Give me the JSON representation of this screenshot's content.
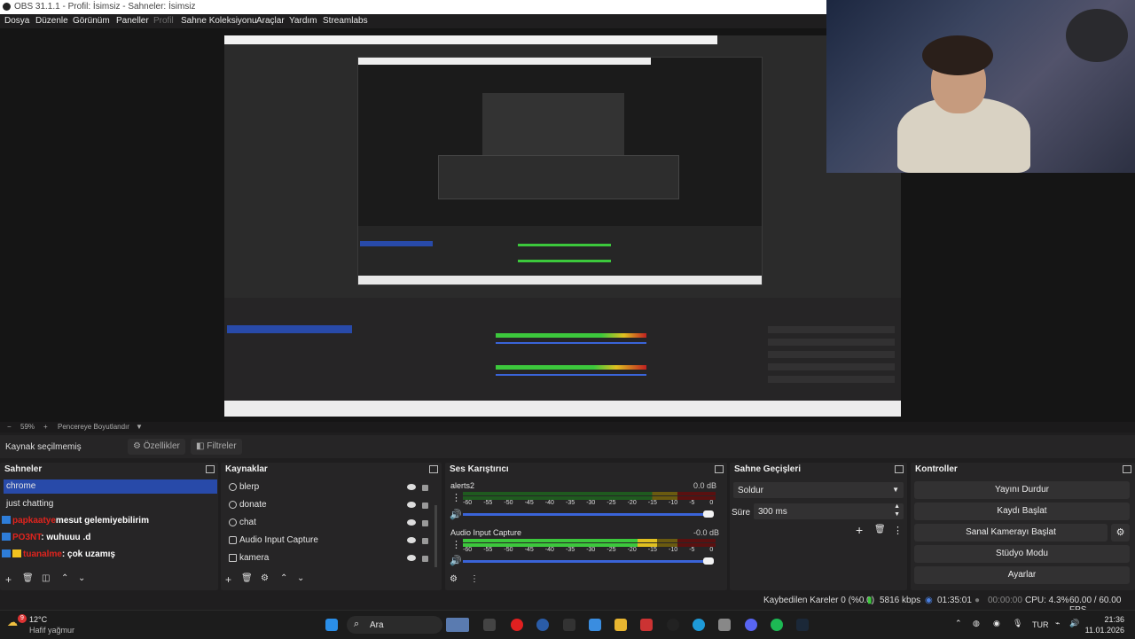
{
  "window": {
    "title": "OBS 31.1.1 - Profil: İsimsiz - Sahneler: İsimsiz"
  },
  "menu": {
    "items": [
      "Dosya",
      "Düzenle",
      "Görünüm",
      "Paneller",
      "Profil",
      "Sahne Koleksiyonu",
      "Araçlar",
      "Yardım",
      "Streamlabs"
    ]
  },
  "zoom": {
    "minus": "−",
    "value": "59%",
    "plus": "+",
    "fit_label": "Pencereye Boyutlandır"
  },
  "source_toolbar": {
    "none_selected": "Kaynak seçilmemiş",
    "properties": "Özellikler",
    "filters": "Filtreler"
  },
  "scenes": {
    "title": "Sahneler",
    "items": [
      "chrome",
      "just chatting"
    ],
    "selected": "chrome",
    "chat_overlay": [
      {
        "user": "papkaatye",
        "message": "mesut gelemiyebilirim"
      },
      {
        "user": "PO3NT",
        "message": ": wuhuuu .d"
      },
      {
        "user": "tuanalme",
        "message": ": çok uzamış"
      }
    ]
  },
  "sources": {
    "title": "Kaynaklar",
    "items": [
      {
        "name": "blerp",
        "icon": "browser-icon"
      },
      {
        "name": "donate",
        "icon": "browser-icon"
      },
      {
        "name": "chat",
        "icon": "browser-icon"
      },
      {
        "name": "Audio Input Capture",
        "icon": "microphone-icon"
      },
      {
        "name": "kamera",
        "icon": "camera-icon"
      }
    ]
  },
  "mixer": {
    "title": "Ses Karıştırıcı",
    "channels": [
      {
        "name": "alerts2",
        "db": "0.0 dB",
        "level": 0.0
      },
      {
        "name": "Audio Input Capture",
        "db": "-0.0 dB",
        "level": 0.77
      }
    ],
    "scale": [
      "-60",
      "-55",
      "-50",
      "-45",
      "-40",
      "-35",
      "-30",
      "-25",
      "-20",
      "-15",
      "-10",
      "-5",
      "0"
    ]
  },
  "transitions": {
    "title": "Sahne Geçişleri",
    "selected": "Soldur",
    "duration_label": "Süre",
    "duration": "300 ms"
  },
  "controls": {
    "title": "Kontroller",
    "buttons": [
      "Yayını Durdur",
      "Kaydı Başlat",
      "Sanal Kamerayı Başlat",
      "Stüdyo Modu",
      "Ayarlar"
    ]
  },
  "status": {
    "dropped": "Kaybedilen Kareler 0 (%0.0)",
    "bitrate": "5816 kbps",
    "stream_time": "01:35:01",
    "rec_time": "00:00:00",
    "cpu": "CPU: 4.3%",
    "fps": "60.00 / 60.00 FPS"
  },
  "taskbar": {
    "weather_temp": "12°C",
    "weather_desc": "Hafif yağmur",
    "weather_badge": "9",
    "search": "Ara",
    "lang": "TUR",
    "time": "21:36",
    "date": "11.01.2026"
  },
  "colors": {
    "selection": "#284aa9",
    "meter_green": "#3cc83c",
    "meter_yellow": "#e0c020",
    "meter_red": "#c02020",
    "slider": "#3a64d8"
  }
}
